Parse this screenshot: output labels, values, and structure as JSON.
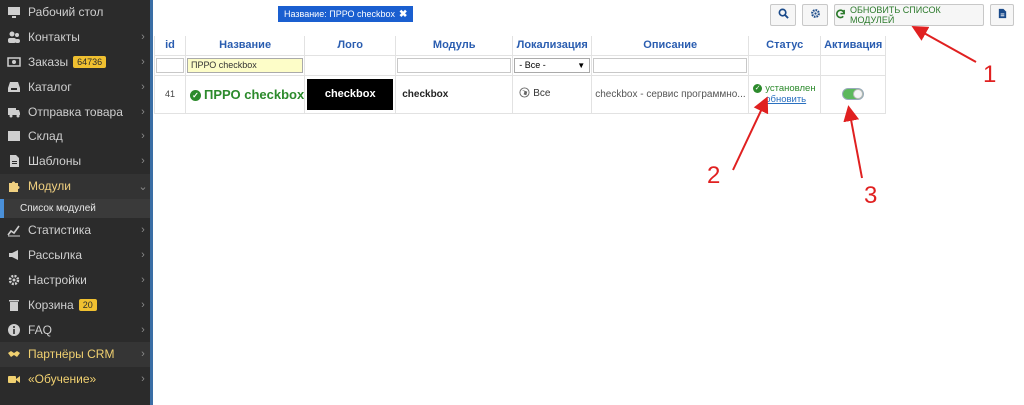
{
  "sidebar": {
    "items": [
      {
        "label": "Рабочий стол",
        "icon": "monitor-icon",
        "chevron": false
      },
      {
        "label": "Контакты",
        "icon": "users-icon",
        "chevron": true
      },
      {
        "label": "Заказы",
        "icon": "money-icon",
        "chevron": true,
        "badge": "64736"
      },
      {
        "label": "Каталог",
        "icon": "inbox-icon",
        "chevron": true
      },
      {
        "label": "Отправка товара",
        "icon": "truck-icon",
        "chevron": true
      },
      {
        "label": "Склад",
        "icon": "box-icon",
        "chevron": true
      },
      {
        "label": "Шаблоны",
        "icon": "file-icon",
        "chevron": true
      },
      {
        "label": "Модули",
        "icon": "puzzle-icon",
        "chevron": true,
        "active": true
      },
      {
        "label": "Статистика",
        "icon": "chart-line-icon",
        "chevron": true
      },
      {
        "label": "Рассылка",
        "icon": "megaphone-icon",
        "chevron": true
      },
      {
        "label": "Настройки",
        "icon": "gear-icon",
        "chevron": true
      },
      {
        "label": "Корзина",
        "icon": "trash-icon",
        "chevron": true,
        "badge": "20"
      },
      {
        "label": "FAQ",
        "icon": "info-icon",
        "chevron": true
      },
      {
        "label": "Партнёры CRM",
        "icon": "handshake-icon",
        "chevron": true,
        "yellow": true
      },
      {
        "label": "«Обучение»",
        "icon": "video-icon",
        "chevron": true,
        "yellow": true
      }
    ],
    "subitem": "Список модулей"
  },
  "filter_chip": {
    "label": "Название: ПРРО checkbox",
    "close": "✖"
  },
  "toolbar": {
    "search_icon": "search-icon",
    "settings_icon": "gear-icon",
    "refresh_label": "ОБНОВИТЬ СПИСОК МОДУЛЕЙ",
    "export_icon": "file-icon"
  },
  "table": {
    "headers": [
      "id",
      "Название",
      "Лого",
      "Модуль",
      "Локализация",
      "Описание",
      "Статус",
      "Активация"
    ],
    "filters": {
      "name_value": "ПРРО checkbox",
      "localization_value": "- Все -"
    },
    "row": {
      "id": "41",
      "name": "ПРРО checkbox",
      "logo_text": "checkbox",
      "module": "checkbox",
      "localization": "Все",
      "description": "checkbox - сервис программно...",
      "status": "установлен",
      "status_action": "обновить",
      "activation": true
    }
  },
  "annotations": {
    "marker_1": "1",
    "marker_2": "2",
    "marker_3": "3",
    "color": "#e02020"
  }
}
